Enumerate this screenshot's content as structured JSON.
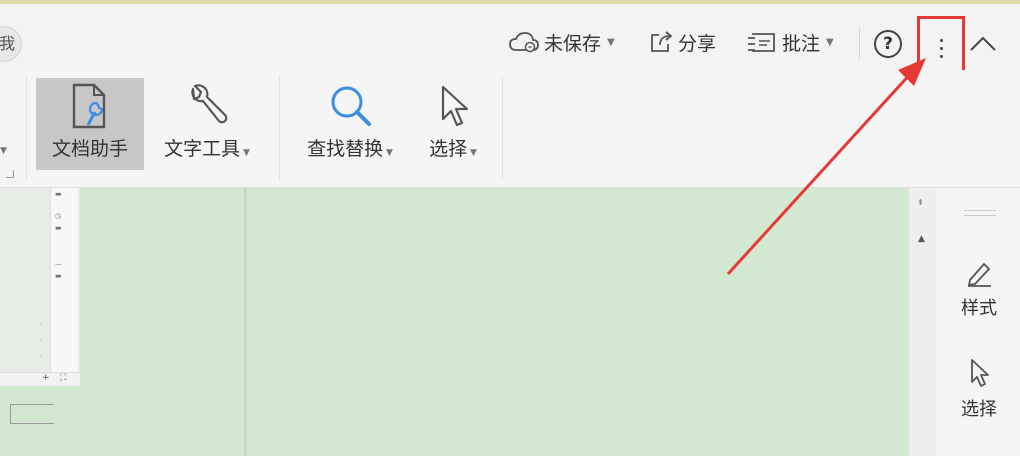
{
  "titlebar": {
    "avatar_char": "我",
    "save_status": "未保存",
    "share": "分享",
    "comment": "批注",
    "help": "?"
  },
  "ribbon": {
    "doc_assistant": "文档助手",
    "text_tools": "文字工具",
    "find_replace": "查找替换",
    "select": "选择"
  },
  "right_rail": {
    "style": "样式",
    "select": "选择"
  },
  "colors": {
    "annotation": "#e53935",
    "workspace_green": "#cfe6cc"
  }
}
